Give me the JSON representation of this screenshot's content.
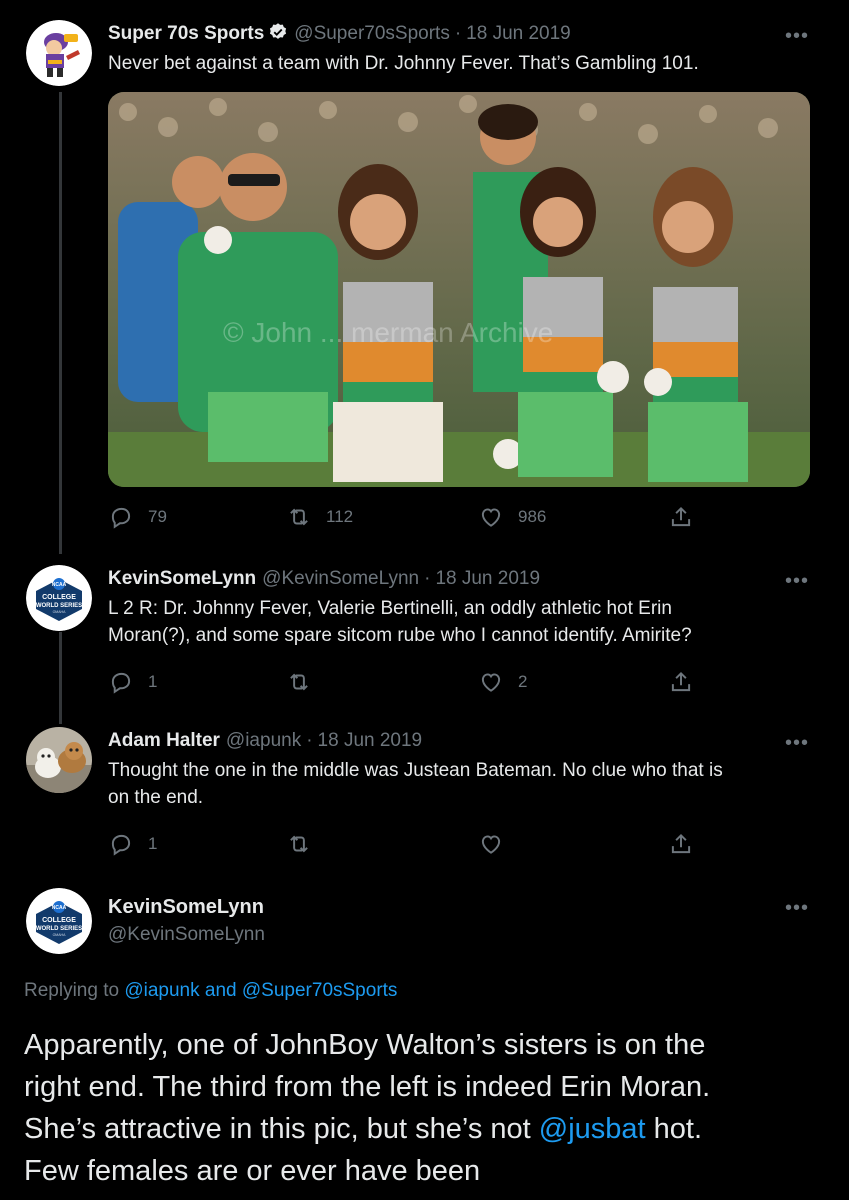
{
  "colors": {
    "background": "#000000",
    "text": "#e7e9ea",
    "muted": "#6e767d",
    "accent": "#1d9bf0"
  },
  "tweets": [
    {
      "name": "Super 70s Sports",
      "verified": true,
      "handle": "@Super70sSports",
      "dot": "·",
      "date": "18 Jun 2019",
      "text": "Never bet against a team with Dr. Johnny Fever. That’s Gambling 101.",
      "watermark": "© John ... merman Archive",
      "replies": "79",
      "retweets": "112",
      "likes": "986",
      "icons": [
        "reply-icon",
        "retweet-icon",
        "like-icon",
        "share-icon"
      ]
    },
    {
      "name": "KevinSomeLynn",
      "handle": "@KevinSomeLynn",
      "dot": "·",
      "date": "18 Jun 2019",
      "text_line1": "L 2 R: Dr. Johnny Fever, Valerie Bertinelli, an oddly athletic hot Erin",
      "text_line2": "Moran(?), and some spare sitcom rube who I cannot identify. Amirite?",
      "replies": "1",
      "retweets": "",
      "likes": "2"
    },
    {
      "name": "Adam Halter",
      "handle": "@iapunk",
      "dot": "·",
      "date": "18 Jun 2019",
      "text_line1": "Thought the one in the middle was Justean Bateman. No clue who that is",
      "text_line2": "on the end.",
      "replies": "1",
      "retweets": "",
      "likes": ""
    }
  ],
  "focused": {
    "name": "KevinSomeLynn",
    "handle": "@KevinSomeLynn",
    "replying_prefix": "Replying to ",
    "mention1": "@iapunk",
    "and": " and ",
    "mention2": "@Super70sSports",
    "line1": "Apparently, one of JohnBoy Walton’s sisters is on the",
    "line2": "right end. The third from the left is indeed Erin Moran.",
    "line3_pre": "She’s attractive in this pic, but she’s not ",
    "line3_mention": "@jusbat",
    "line3_post": " hot.",
    "line4": "Few females are or ever have been"
  },
  "avatar_logo": {
    "top": "NCAA",
    "line1": "COLLEGE",
    "line2": "WORLD SERIES",
    "line3": "OMAHA"
  }
}
